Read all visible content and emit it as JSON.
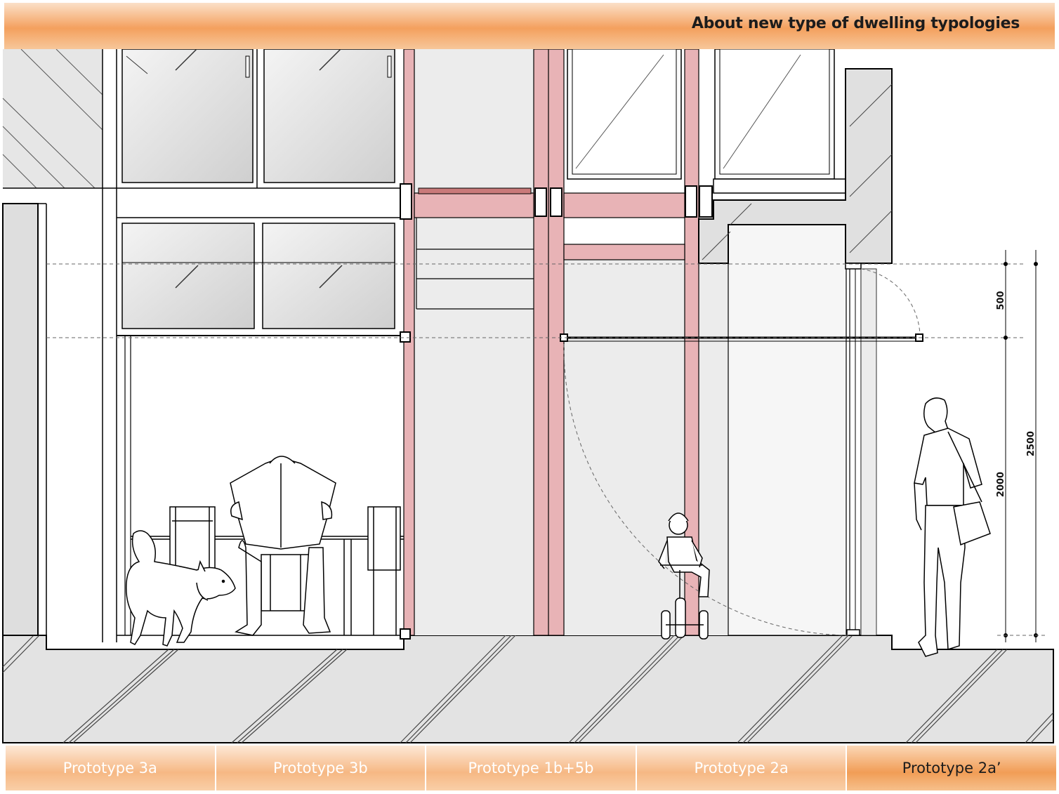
{
  "header": {
    "title": "About new type of dwelling typologies"
  },
  "dimensions": {
    "top": "500",
    "mid": "2000",
    "total": "2500"
  },
  "tabs": [
    {
      "label": "Prototype 3a",
      "active": false
    },
    {
      "label": "Prototype 3b",
      "active": false
    },
    {
      "label": "Prototype 1b+5b",
      "active": false
    },
    {
      "label": "Prototype 2a",
      "active": false
    },
    {
      "label": "Prototype 2a’",
      "active": true
    }
  ],
  "colors": {
    "accent": "#f4a05e",
    "structure": "#e8b3b6",
    "shade": "#e1e1e1"
  },
  "figures": [
    "person-reading-newspaper",
    "dog",
    "child-on-tricycle",
    "standing-man"
  ]
}
